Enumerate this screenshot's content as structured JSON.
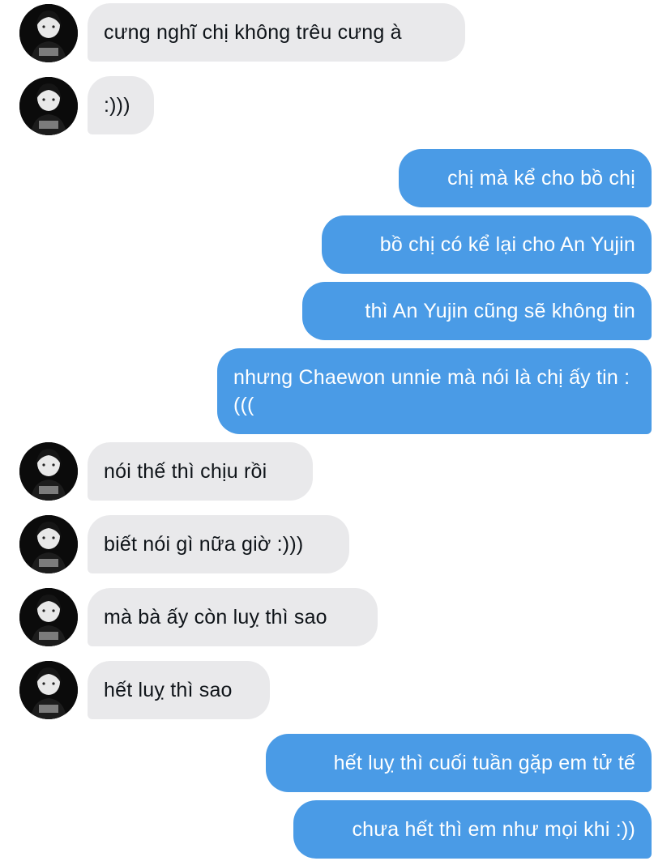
{
  "messages": [
    {
      "id": "m1",
      "direction": "incoming",
      "text": "cưng nghĩ chị không trêu cưng à"
    },
    {
      "id": "m2",
      "direction": "incoming",
      "text": ":)))"
    },
    {
      "id": "m3",
      "direction": "outgoing",
      "text": "chị mà kể cho bồ chị"
    },
    {
      "id": "m4",
      "direction": "outgoing",
      "text": "bồ chị có kể lại cho An Yujin"
    },
    {
      "id": "m5",
      "direction": "outgoing",
      "text": "thì An Yujin cũng sẽ không tin"
    },
    {
      "id": "m6",
      "direction": "outgoing",
      "text": "nhưng Chaewon unnie mà nói là chị ấy tin :((("
    },
    {
      "id": "m7",
      "direction": "incoming",
      "text": "nói thế thì chịu rồi"
    },
    {
      "id": "m8",
      "direction": "incoming",
      "text": "biết nói gì nữa giờ :)))"
    },
    {
      "id": "m9",
      "direction": "incoming",
      "text": "mà bà ấy còn luỵ thì sao"
    },
    {
      "id": "m10",
      "direction": "incoming",
      "text": "hết luỵ thì sao"
    },
    {
      "id": "m11",
      "direction": "outgoing",
      "text": "hết luỵ thì cuối tuần gặp em tử tế"
    },
    {
      "id": "m12",
      "direction": "outgoing",
      "text": "chưa hết thì em như mọi khi :))"
    }
  ],
  "colors": {
    "incoming_bubble": "#e9e9eb",
    "outgoing_bubble": "#4a9be6",
    "incoming_text": "#0f1419",
    "outgoing_text": "#ffffff"
  },
  "icons": {
    "avatar": "contact-avatar-photo"
  }
}
